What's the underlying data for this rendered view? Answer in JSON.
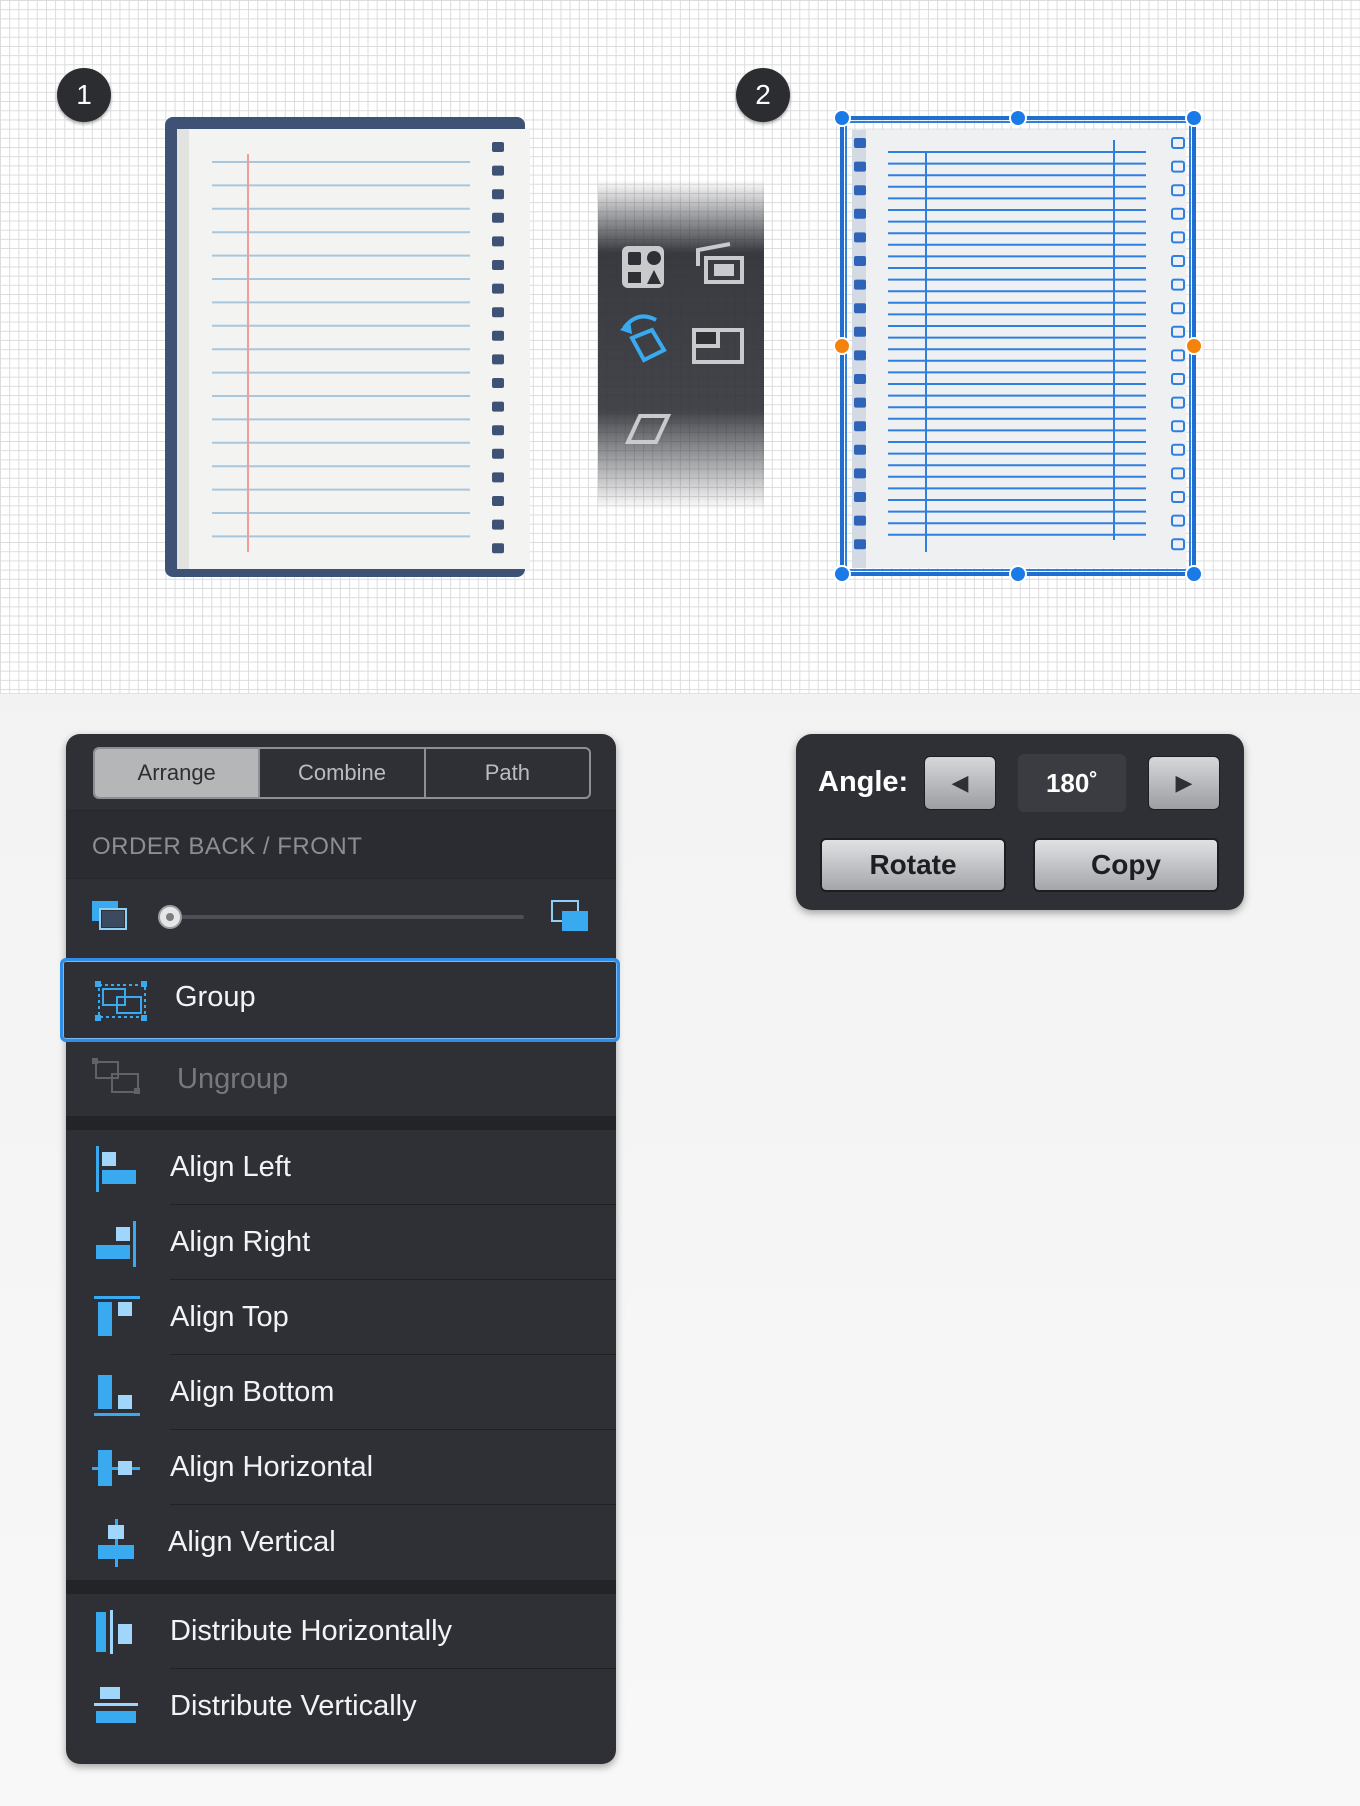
{
  "steps": {
    "one": "1",
    "two": "2"
  },
  "arrange_panel": {
    "tabs": [
      {
        "label": "Arrange"
      },
      {
        "label": "Combine"
      },
      {
        "label": "Path"
      }
    ],
    "section_title": "ORDER BACK / FRONT",
    "order_slider": {
      "level": 0
    },
    "group": {
      "label": "Group"
    },
    "ungroup": {
      "label": "Ungroup"
    },
    "align": [
      {
        "label": "Align Left"
      },
      {
        "label": "Align Right"
      },
      {
        "label": "Align Top"
      },
      {
        "label": "Align Bottom"
      },
      {
        "label": "Align Horizontal"
      },
      {
        "label": "Align Vertical"
      }
    ],
    "distribute": [
      {
        "label": "Distribute Horizontally"
      },
      {
        "label": "Distribute Vertically"
      }
    ]
  },
  "angle_panel": {
    "label": "Angle:",
    "value": "180˚",
    "rotate_label": "Rotate",
    "copy_label": "Copy"
  },
  "colors": {
    "accent_blue": "#2f8ee6",
    "icon_blue": "#3aaaf0",
    "handle_orange": "#f5820b",
    "panel_bg": "#2e3036"
  }
}
